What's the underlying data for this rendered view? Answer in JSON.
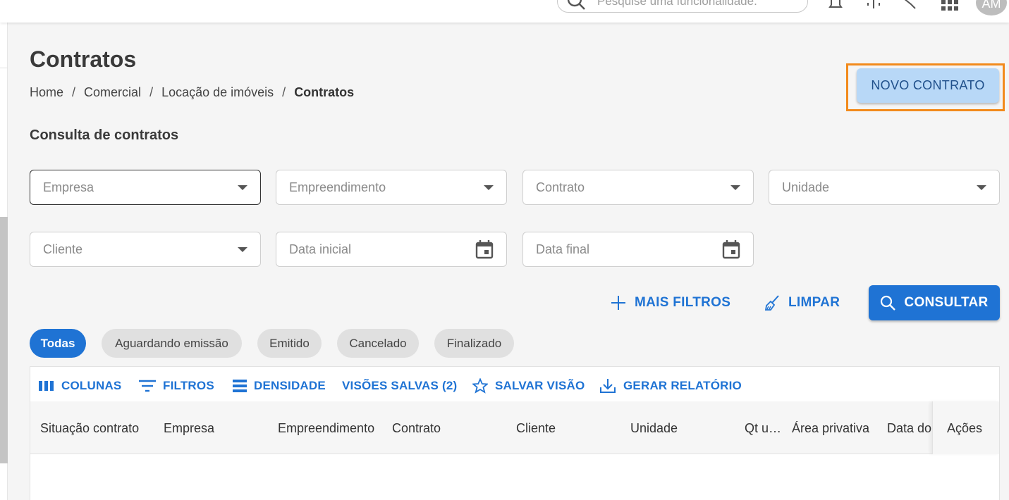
{
  "topbar": {
    "search_placeholder": "Pesquise uma funcionalidade.",
    "avatar_initials": "AM"
  },
  "page": {
    "title": "Contratos",
    "breadcrumb": [
      "Home",
      "Comercial",
      "Locação de imóveis",
      "Contratos"
    ],
    "breadcrumb_sep": "/",
    "new_button": "NOVO CONTRATO",
    "section_title": "Consulta de contratos"
  },
  "filters": {
    "empresa": "Empresa",
    "empreendimento": "Empreendimento",
    "contrato": "Contrato",
    "unidade": "Unidade",
    "cliente": "Cliente",
    "data_inicial": "Data inicial",
    "data_final": "Data final"
  },
  "actions": {
    "mais_filtros": "MAIS FILTROS",
    "limpar": "LIMPAR",
    "consultar": "CONSULTAR"
  },
  "chips": [
    "Todas",
    "Aguardando emissão",
    "Emitido",
    "Cancelado",
    "Finalizado"
  ],
  "grid": {
    "toolbar": [
      "COLUNAS",
      "FILTROS",
      "DENSIDADE",
      "VISÕES SALVAS (2)",
      "SALVAR VISÃO",
      "GERAR RELATÓRIO"
    ],
    "columns": [
      "Situação contrato",
      "Empresa",
      "Empreendimento",
      "Contrato",
      "Cliente",
      "Unidade",
      "Qt u…",
      "Área privativa",
      "Data do",
      "Ações"
    ]
  },
  "colors": {
    "primary": "#1f73d4",
    "highlight": "#f28a1c",
    "new_button_bg": "#b8d8f7"
  }
}
